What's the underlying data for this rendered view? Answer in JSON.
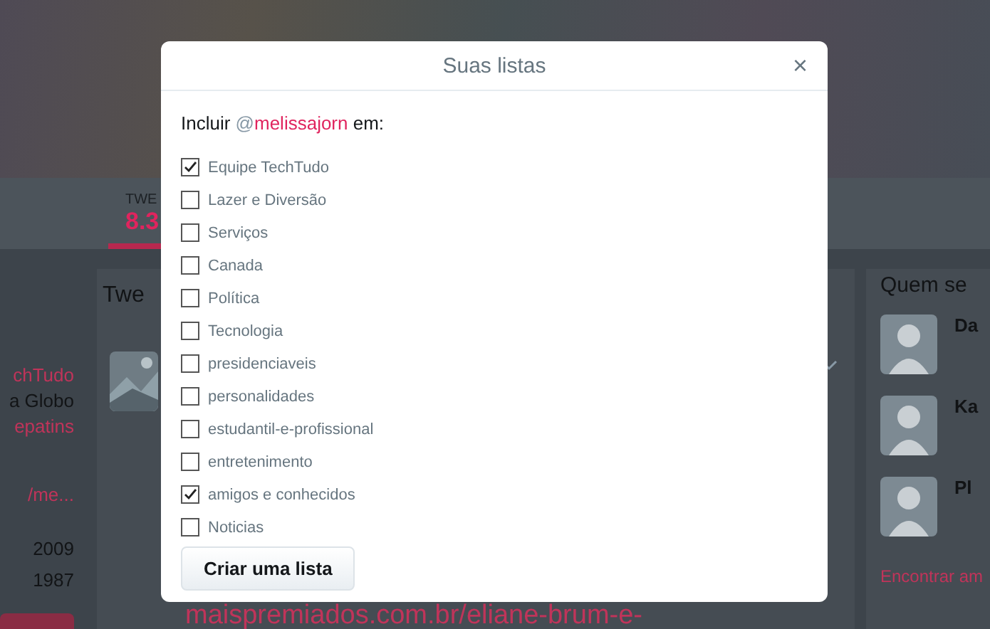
{
  "background": {
    "stats": [
      {
        "label": "TWE",
        "value": "8.3",
        "selected": true
      }
    ],
    "profile_lines": [
      {
        "text": "chTudo",
        "kind": "link"
      },
      {
        "text": "a Globo",
        "kind": "plain"
      },
      {
        "text": "epatins",
        "kind": "link"
      },
      {
        "text": "/me...",
        "kind": "link"
      },
      {
        "text": "2009",
        "kind": "plain"
      },
      {
        "text": "1987",
        "kind": "plain"
      }
    ],
    "timeline_title": "Twe",
    "tweet_link": "maispremiados.com.br/eliane-brum-e-",
    "who_to_follow": {
      "title": "Quem se",
      "users": [
        {
          "name": "Da"
        },
        {
          "name": "Ka"
        },
        {
          "name": "Pl"
        }
      ],
      "find_link": "Encontrar am"
    }
  },
  "dialog": {
    "title": "Suas listas",
    "close": "×",
    "prompt": {
      "before": "Incluir",
      "at": "@",
      "handle": "melissajorn",
      "after": "em:"
    },
    "lists": [
      {
        "name": "Equipe TechTudo",
        "checked": true
      },
      {
        "name": "Lazer e Diversão",
        "checked": false
      },
      {
        "name": "Serviços",
        "checked": false
      },
      {
        "name": "Canada",
        "checked": false
      },
      {
        "name": "Política",
        "checked": false
      },
      {
        "name": "Tecnologia",
        "checked": false
      },
      {
        "name": "presidenciaveis",
        "checked": false
      },
      {
        "name": "personalidades",
        "checked": false
      },
      {
        "name": "estudantil-e-profissional",
        "checked": false
      },
      {
        "name": "entretenimento",
        "checked": false
      },
      {
        "name": "amigos e conhecidos",
        "checked": true
      },
      {
        "name": "Noticias",
        "checked": false
      }
    ],
    "create_button": "Criar uma lista"
  }
}
